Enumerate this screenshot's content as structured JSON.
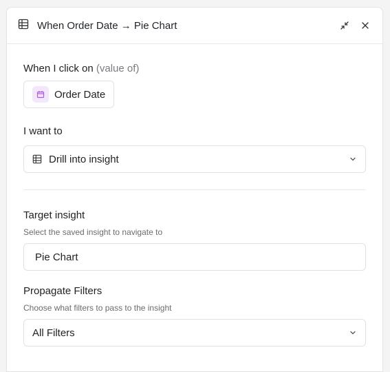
{
  "header": {
    "title": "When Order Date → Pie Chart",
    "icons": {
      "table": "table-icon",
      "collapse": "collapse-icon",
      "close": "close-icon"
    }
  },
  "trigger": {
    "label": "When I click on",
    "label_muted": "(value of)",
    "field_name": "Order Date",
    "field_icon": "calendar-icon",
    "accent": "#b15ad8"
  },
  "action": {
    "label": "I want to",
    "selected": "Drill into insight",
    "icon": "table-icon"
  },
  "target": {
    "label": "Target insight",
    "help": "Select the saved insight to navigate to",
    "value": "Pie Chart"
  },
  "filters": {
    "label": "Propagate Filters",
    "help": "Choose what filters to pass to the insight",
    "selected": "All Filters"
  }
}
